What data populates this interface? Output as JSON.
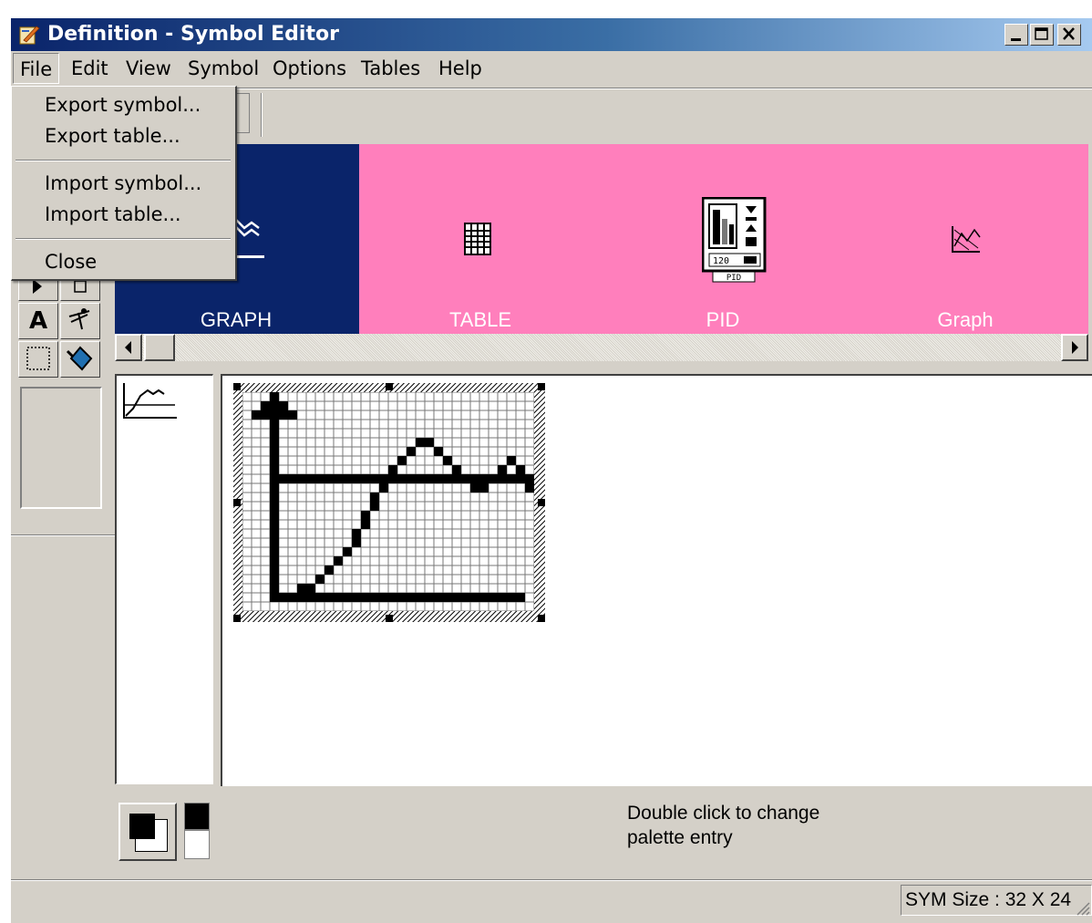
{
  "window": {
    "title": "Definition - Symbol Editor",
    "accent_color": "#0a246a",
    "caption_buttons": [
      "minimize-icon",
      "maximize-icon",
      "close-icon"
    ]
  },
  "menu": {
    "items": [
      "File",
      "Edit",
      "View",
      "Symbol",
      "Options",
      "Tables",
      "Help"
    ],
    "open_menu": "File"
  },
  "file_menu": {
    "export_symbol": "Export symbol...",
    "export_table": "Export table...",
    "import_symbol": "Import symbol...",
    "import_table": "Import table...",
    "close": "Close"
  },
  "symbol_strip": {
    "background_color": "#ff7fbc",
    "selected_color": "#0a246a",
    "items": [
      {
        "label": "GRAPH",
        "icon": "graph-symbol-icon",
        "selected": true
      },
      {
        "label": "TABLE",
        "icon": "table-symbol-icon",
        "selected": false
      },
      {
        "label": "PID",
        "icon": "pid-symbol-icon",
        "selected": false
      },
      {
        "label": "Graph",
        "icon": "graph-small-symbol-icon",
        "selected": false
      }
    ],
    "pid_caption": "PID",
    "pid_value": "120"
  },
  "tools": {
    "items": [
      "pointer-tool-icon",
      "fill-tool-icon",
      "text-tool-icon",
      "line-tool-icon",
      "select-rect-tool-icon",
      "paint-bucket-tool-icon"
    ],
    "text_tool_glyph": "A"
  },
  "palette": {
    "foreground": "#000000",
    "background": "#ffffff",
    "hint": "Double click to change palette entry",
    "hint_line1": "Double click to change",
    "hint_line2": "palette entry"
  },
  "status": {
    "sym_size": "SYM Size : 32 X 24"
  }
}
